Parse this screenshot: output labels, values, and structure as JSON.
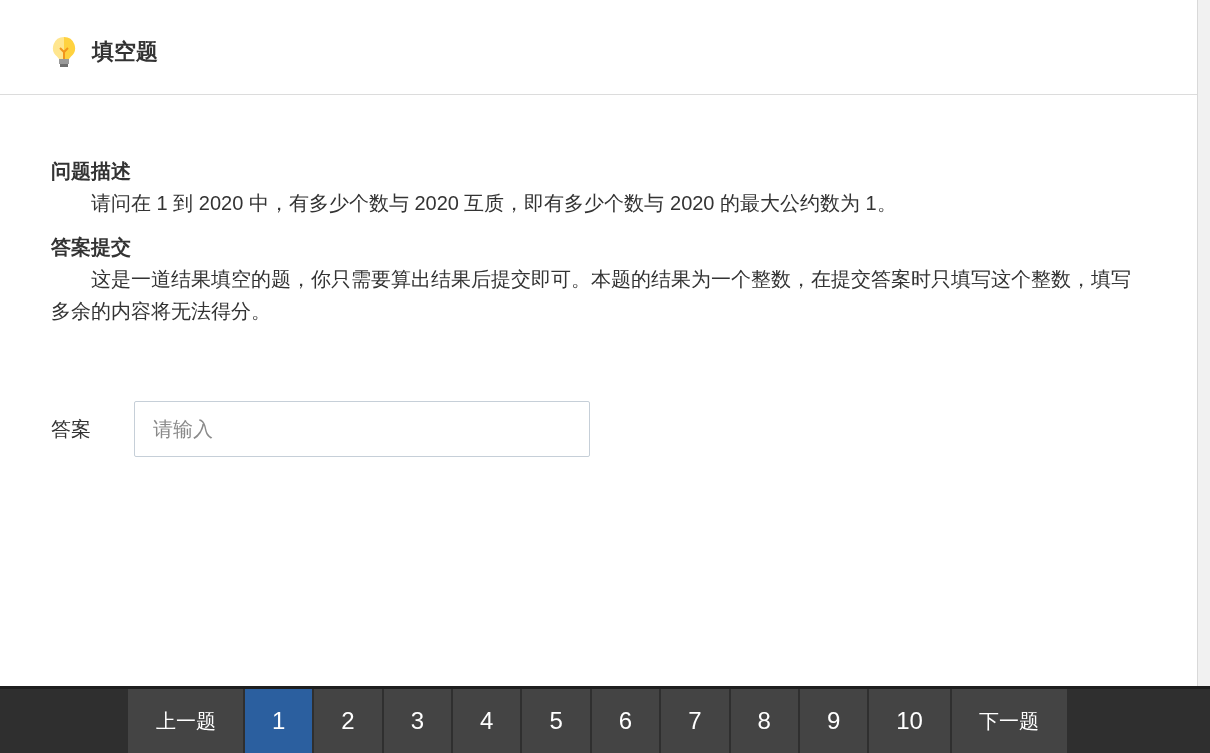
{
  "header": {
    "title": "填空题"
  },
  "sections": [
    {
      "heading": "问题描述",
      "paragraphs": [
        "请问在 1 到 2020 中，有多少个数与 2020 互质，即有多少个数与 2020 的最大公约数为 1。"
      ]
    },
    {
      "heading": "答案提交",
      "paragraphs": [
        "这是一道结果填空的题，你只需要算出结果后提交即可。本题的结果为一个整数，在提交答案时只填写这个整数，填写多余的内容将无法得分。"
      ]
    }
  ],
  "answer": {
    "label": "答案",
    "placeholder": "请输入"
  },
  "pager": {
    "prev": "上一题",
    "pages": [
      {
        "label": "1",
        "selected": true
      },
      {
        "label": "2",
        "selected": false
      },
      {
        "label": "3",
        "selected": false
      },
      {
        "label": "4",
        "selected": false
      },
      {
        "label": "5",
        "selected": false
      },
      {
        "label": "6",
        "selected": false
      },
      {
        "label": "7",
        "selected": false
      },
      {
        "label": "8",
        "selected": false
      },
      {
        "label": "9",
        "selected": false
      },
      {
        "label": "10",
        "selected": false
      }
    ],
    "next": "下一题"
  }
}
